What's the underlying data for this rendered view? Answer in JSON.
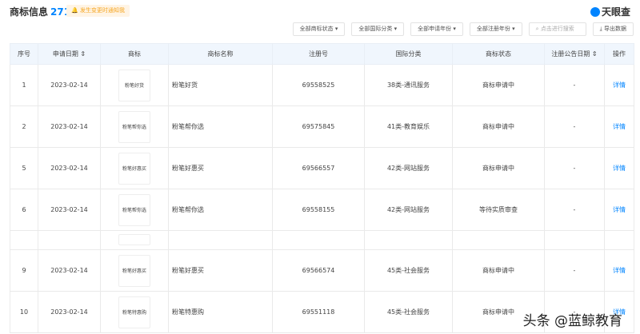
{
  "header": {
    "title": "商标信息",
    "count": "271",
    "notify": "发生变更时通知我",
    "logo": "天眼查"
  },
  "filters": [
    "全部商标状态 ▾",
    "全部国际分类 ▾",
    "全部申请年份 ▾",
    "全部注册年份 ▾"
  ],
  "search_placeholder": "点击进行搜索",
  "search_icon": "search-icon",
  "export": "导出数据",
  "columns": [
    "序号",
    "申请日期 ⇕",
    "商标",
    "商标名称",
    "注册号",
    "国际分类",
    "商标状态",
    "注册公告日期 ⇕",
    "操作"
  ],
  "rows": [
    {
      "no": "1",
      "date": "2023-02-14",
      "logo": "粉笔好货",
      "name": "粉笔好货",
      "reg": "69558525",
      "cls": "38类-通讯服务",
      "status": "商标申请中",
      "pub": "-",
      "op": "详情"
    },
    {
      "no": "2",
      "date": "2023-02-14",
      "logo": "粉笔帮你选",
      "name": "粉笔帮你选",
      "reg": "69575845",
      "cls": "41类-教育娱乐",
      "status": "商标申请中",
      "pub": "-",
      "op": "详情"
    },
    {
      "no": "5",
      "date": "2023-02-14",
      "logo": "粉笔好惠买",
      "name": "粉笔好惠买",
      "reg": "69566557",
      "cls": "42类-网站服务",
      "status": "商标申请中",
      "pub": "-",
      "op": "详情"
    },
    {
      "no": "6",
      "date": "2023-02-14",
      "logo": "粉笔帮你选",
      "name": "粉笔帮你选",
      "reg": "69558155",
      "cls": "42类-网站服务",
      "status": "等待实质审查",
      "pub": "-",
      "op": "详情"
    },
    {
      "no": "9",
      "date": "2023-02-14",
      "logo": "粉笔好惠买",
      "name": "粉笔好惠买",
      "reg": "69566574",
      "cls": "45类-社会服务",
      "status": "商标申请中",
      "pub": "-",
      "op": "详情"
    },
    {
      "no": "10",
      "date": "2023-02-14",
      "logo": "粉笔特惠购",
      "name": "粉笔特惠购",
      "reg": "69551118",
      "cls": "45类-社会服务",
      "status": "商标申请中",
      "pub": "-",
      "op": "详情"
    }
  ],
  "watermark": "头条 @蓝鲸教育"
}
